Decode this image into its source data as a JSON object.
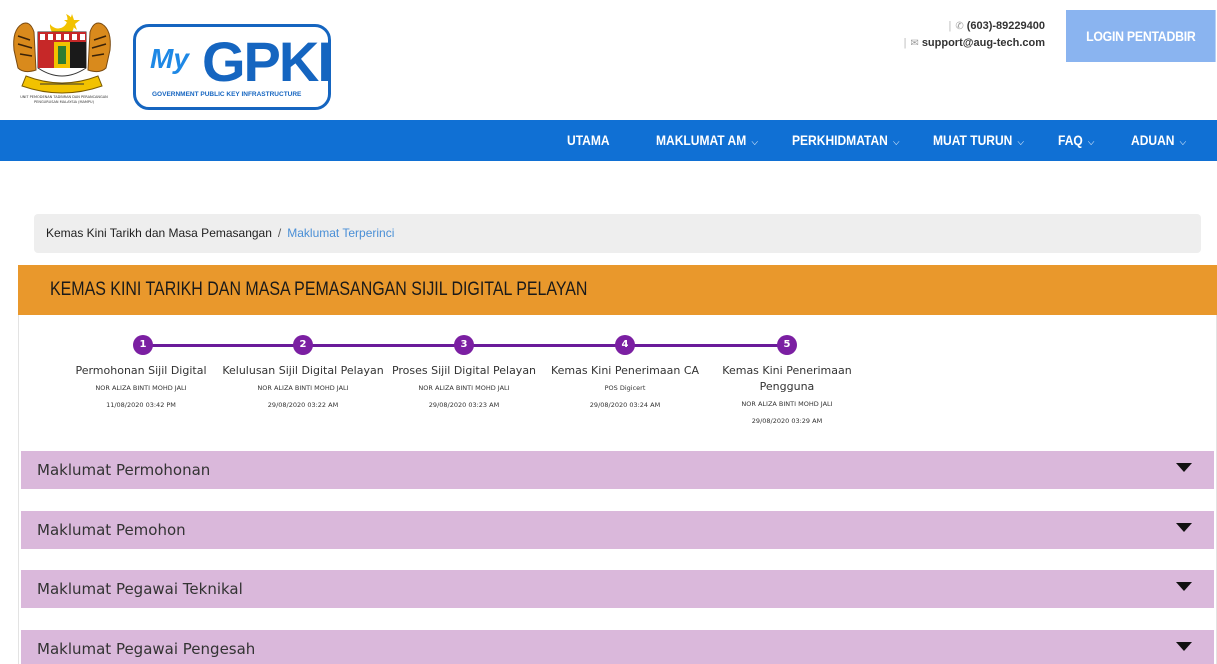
{
  "header": {
    "crest_caption": "UNIT PEMODENAN TADBIRAN DAN PERANCANGAN PENGURUSAN MALAYSIA (MAMPU)",
    "logo_my": "My",
    "logo_pki": "GPKI",
    "logo_sub": "GOVERNMENT PUBLIC KEY INFRASTRUCTURE",
    "phone": "(603)-89229400",
    "email": "support@aug-tech.com",
    "login_label": "LOGIN PENTADBIR"
  },
  "nav": {
    "items": [
      {
        "label": "UTAMA"
      },
      {
        "label": "MAKLUMAT AM"
      },
      {
        "label": "PERKHIDMATAN"
      },
      {
        "label": "MUAT TURUN"
      },
      {
        "label": "FAQ"
      },
      {
        "label": "ADUAN"
      }
    ]
  },
  "breadcrumb": {
    "parent": "Kemas Kini Tarikh dan Masa Pemasangan",
    "separator": "/",
    "current": "Maklumat Terperinci"
  },
  "section": {
    "title": "KEMAS KINI TARIKH DAN MASA PEMASANGAN SIJIL DIGITAL PELAYAN"
  },
  "steps": [
    {
      "number": "1",
      "title": "Permohonan Sijil Digital",
      "user": "NOR ALIZA BINTI MOHD JALI",
      "date": "11/08/2020 03:42 PM"
    },
    {
      "number": "2",
      "title": "Kelulusan Sijil Digital Pelayan",
      "user": "NOR ALIZA BINTI MOHD JALI",
      "date": "29/08/2020 03:22 AM"
    },
    {
      "number": "3",
      "title": "Proses Sijil Digital Pelayan",
      "user": "NOR ALIZA BINTI MOHD JALI",
      "date": "29/08/2020 03:23 AM"
    },
    {
      "number": "4",
      "title": "Kemas Kini Penerimaan CA",
      "user": "POS Digicert",
      "date": "29/08/2020 03:24 AM"
    },
    {
      "number": "5",
      "title": "Kemas Kini Penerimaan Pengguna",
      "user": "NOR ALIZA BINTI MOHD JALI",
      "date": "29/08/2020 03:29 AM"
    }
  ],
  "accordions": [
    {
      "label": "Maklumat Permohonan"
    },
    {
      "label": "Maklumat Pemohon"
    },
    {
      "label": "Maklumat Pegawai Teknikal"
    },
    {
      "label": "Maklumat Pegawai Pengesah"
    }
  ],
  "colors": {
    "nav": "#1070d4",
    "banner": "#e9982c",
    "stepper": "#7b1fa2",
    "accordion": "#dab8db",
    "login": "#8ab4f0"
  }
}
